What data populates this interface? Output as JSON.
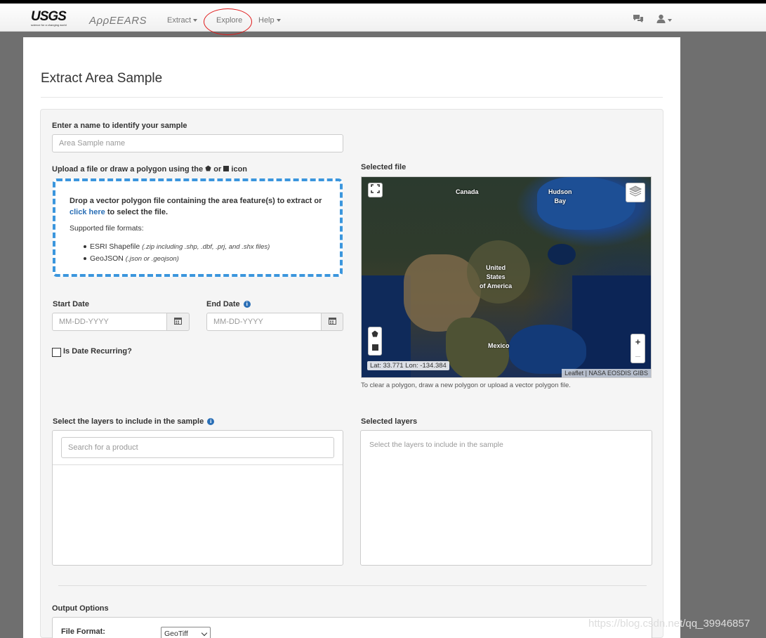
{
  "nav": {
    "logo_text": "USGS",
    "logo_tagline": "science for a changing world",
    "app_name": "AρρEEARS",
    "extract_label": "Extract",
    "explore_label": "Explore",
    "help_label": "Help"
  },
  "page": {
    "title": "Extract Area Sample"
  },
  "form": {
    "sample_name_label": "Enter a name to identify your sample",
    "sample_name_placeholder": "Area Sample name",
    "upload_label_prefix": "Upload a file or draw a polygon using the",
    "upload_label_or": "or",
    "upload_label_suffix": "icon",
    "dropzone_text_1": "Drop a vector polygon file containing the area feature(s) to extract or",
    "dropzone_link": "click here",
    "dropzone_text_2": "to select the file.",
    "supported_formats_label": "Supported file formats:",
    "formats": [
      {
        "name": "ESRI Shapefile",
        "hint": "(.zip including .shp, .dbf, .prj, and .shx files)"
      },
      {
        "name": "GeoJSON",
        "hint": "(.json or .geojson)"
      }
    ],
    "start_date_label": "Start Date",
    "end_date_label": "End Date",
    "date_placeholder": "MM-DD-YYYY",
    "recurring_label": "Is Date Recurring?",
    "layers_label": "Select the layers to include in the sample",
    "search_placeholder": "Search for a product",
    "selected_layers_label": "Selected layers",
    "selected_layers_placeholder": "Select the layers to include in the sample",
    "output_options_label": "Output Options",
    "file_format_label": "File Format:",
    "file_format_value": "GeoTiff"
  },
  "map": {
    "selected_file_label": "Selected file",
    "labels": {
      "canada": "Canada",
      "hudson_bay": "Hudson\nBay",
      "usa": "United\nStates\nof America",
      "mexico": "Mexico"
    },
    "coords_text": "Lat: 33.771 Lon: -134.384",
    "attribution": "Leaflet | NASA EOSDIS GIBS",
    "zoom_in": "+",
    "zoom_out": "–",
    "note": "To clear a polygon, draw a new polygon or upload a vector polygon file."
  },
  "watermark": "https://blog.csdn.net/qq_39946857"
}
